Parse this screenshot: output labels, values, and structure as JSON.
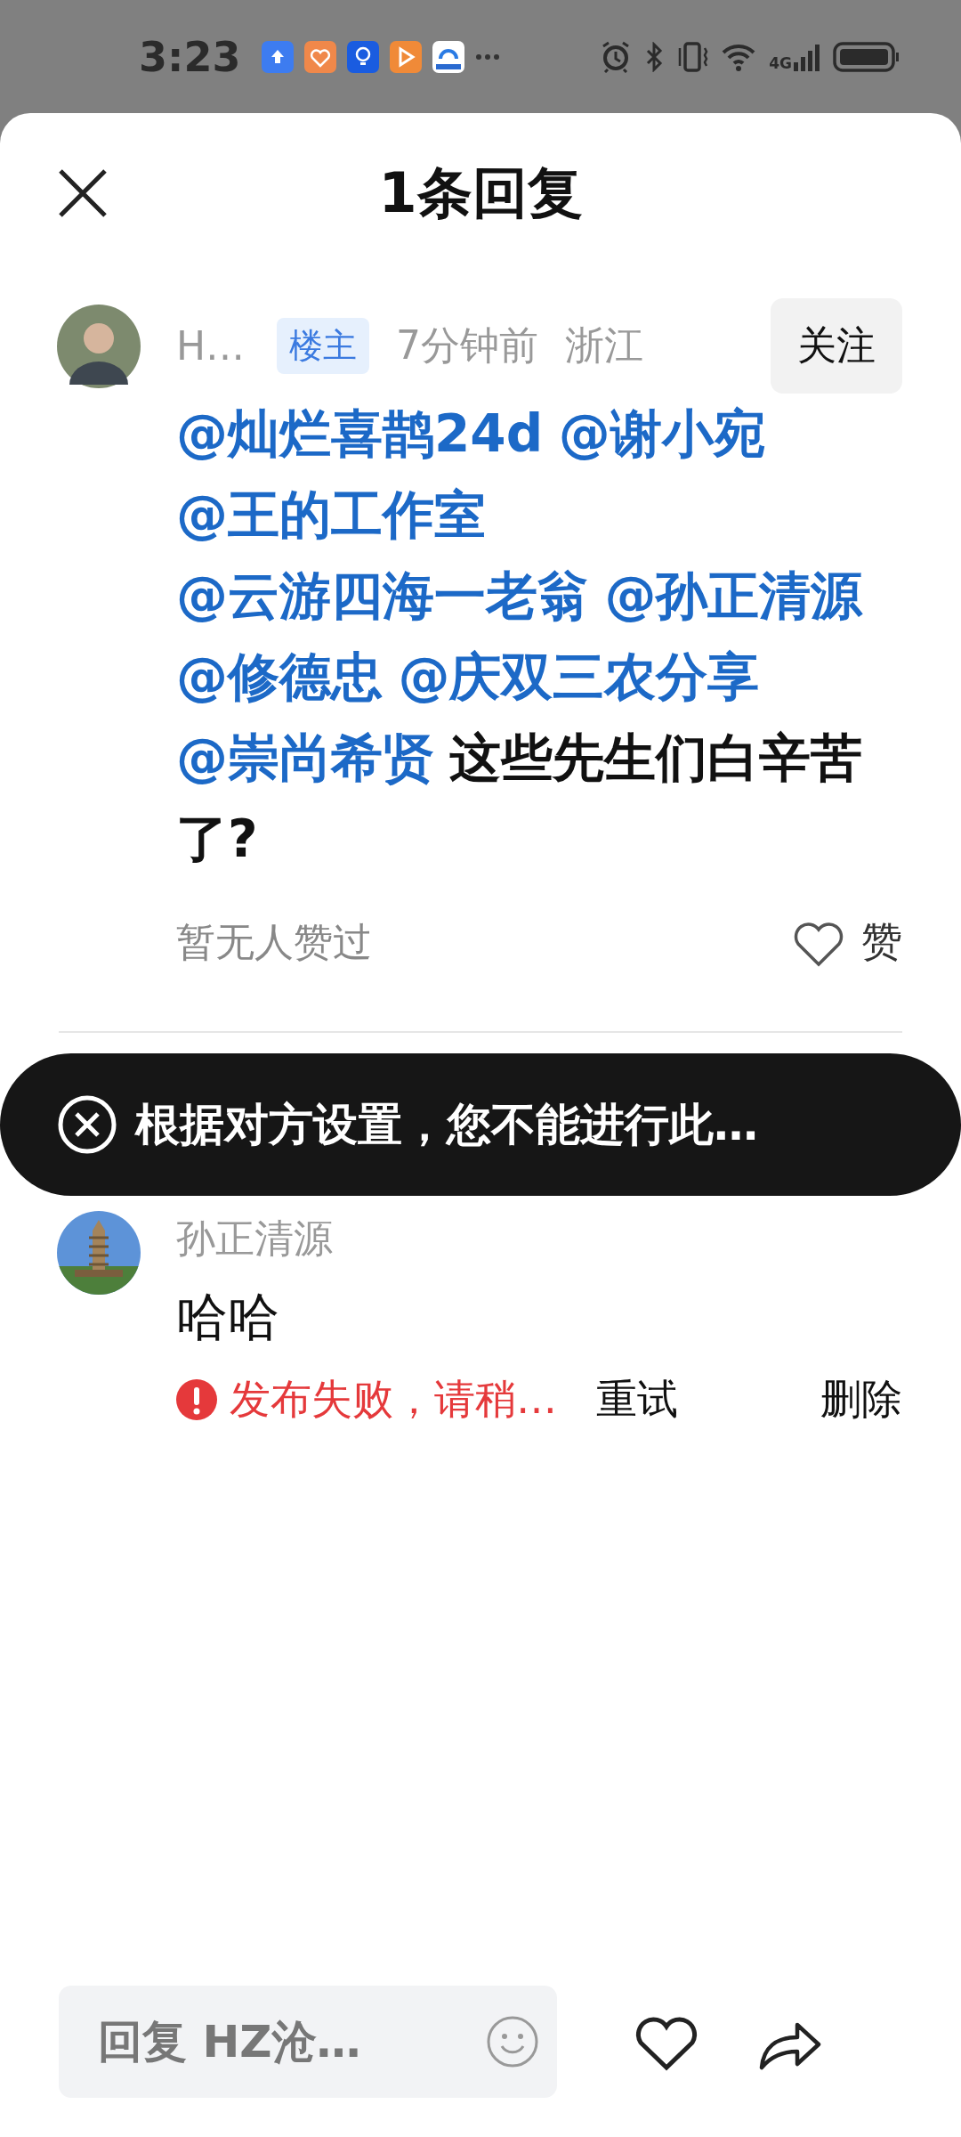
{
  "status_bar": {
    "time": "3:23",
    "network": "4G"
  },
  "header": {
    "title": "1条回复"
  },
  "post": {
    "author": "H…",
    "badge": "楼主",
    "time": "7分钟前",
    "location": "浙江",
    "follow_label": "关注",
    "content": [
      {
        "kind": "mention",
        "text": "@灿烂喜鹊24d"
      },
      {
        "kind": "mention",
        "text": "@谢小宛"
      },
      {
        "kind": "mention",
        "text": "@王的工作室"
      },
      {
        "kind": "mention",
        "text": "@云游四海一老翁"
      },
      {
        "kind": "mention",
        "text": "@孙正清源"
      },
      {
        "kind": "mention",
        "text": "@修德忠"
      },
      {
        "kind": "mention",
        "text": "@庆双三农分享"
      },
      {
        "kind": "mention",
        "text": "@崇尚希贤"
      },
      {
        "kind": "text",
        "text": "这些先生们白辛苦了?"
      }
    ],
    "likes_text": "暂无人赞过",
    "like_label": "赞"
  },
  "toast": {
    "message": "根据对方设置，您不能进行此…"
  },
  "replies": [
    {
      "author": "孙正清源",
      "text": "哈哈",
      "error": "发布失败，请稍…",
      "actions": [
        "重试",
        "删除"
      ]
    }
  ],
  "reply_bar": {
    "placeholder": "回复 HZ沧…"
  }
}
